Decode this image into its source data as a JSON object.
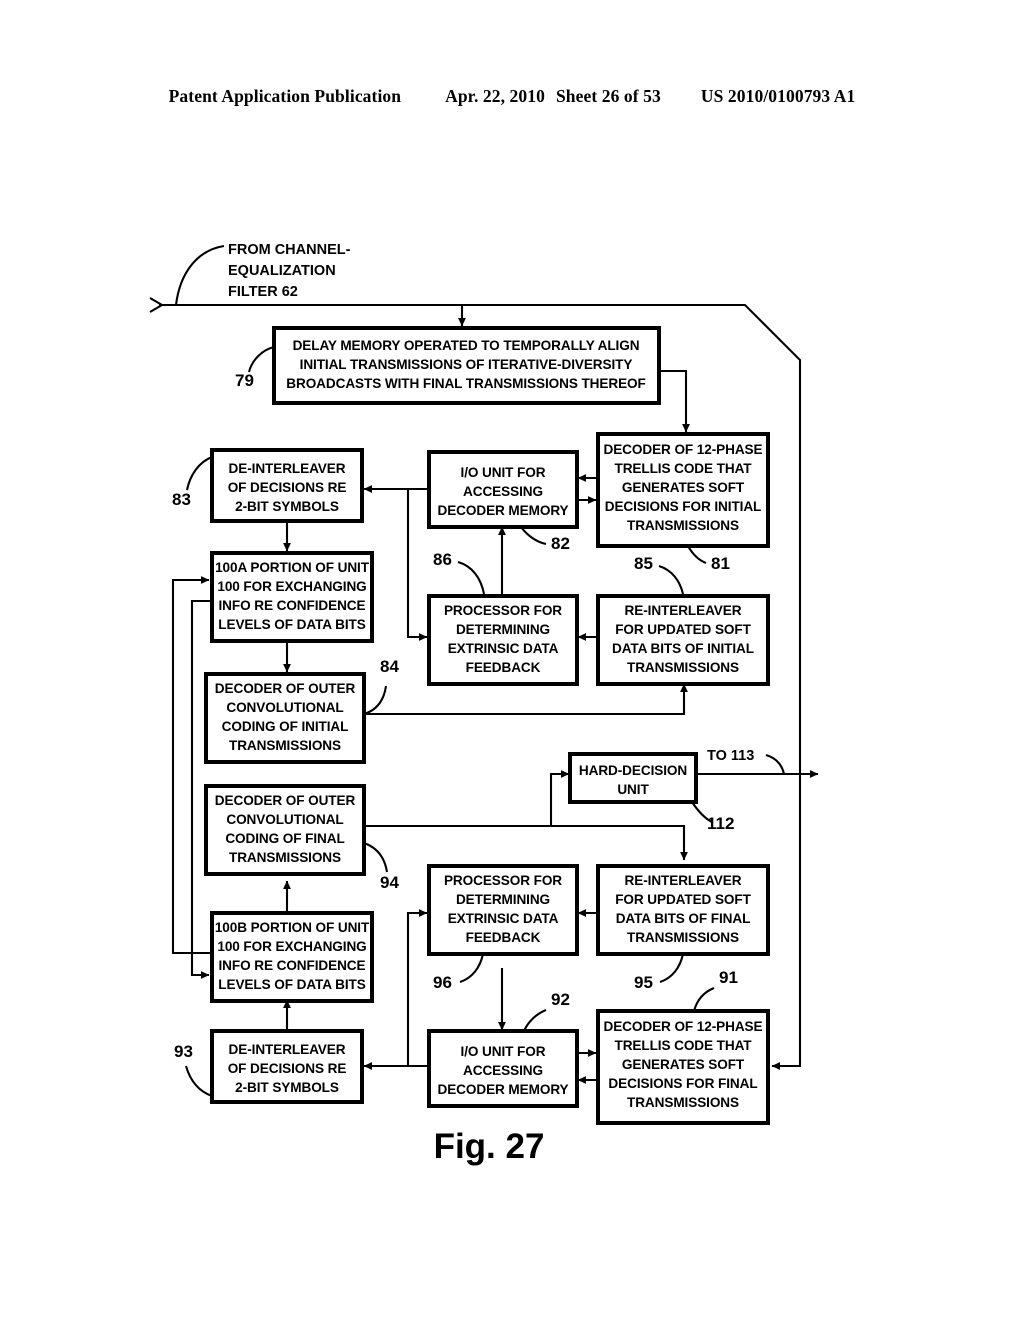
{
  "header": {
    "publication": "Patent Application Publication",
    "date": "Apr. 22, 2010",
    "sheet": "Sheet 26 of 53",
    "patent_number": "US 2010/0100793 A1"
  },
  "figure": {
    "caption": "Fig. 27",
    "input_annotation": [
      "FROM CHANNEL-",
      "EQUALIZATION",
      "FILTER 62"
    ],
    "output_annotation": "TO 113"
  },
  "blocks": [
    {
      "id": "b79",
      "ref": "79",
      "lines": [
        "DELAY MEMORY OPERATED TO TEMPORALLY ALIGN",
        "INITIAL TRANSMISSIONS OF ITERATIVE-DIVERSITY",
        "BROADCASTS WITH FINAL TRANSMISSIONS THEREOF"
      ]
    },
    {
      "id": "b83",
      "ref": "83",
      "lines": [
        "DE-INTERLEAVER",
        "OF DECISIONS RE",
        "2-BIT SYMBOLS"
      ]
    },
    {
      "id": "b82",
      "ref": "82",
      "lines": [
        "I/O UNIT FOR",
        "ACCESSING",
        "DECODER MEMORY"
      ]
    },
    {
      "id": "b81",
      "ref": "81",
      "lines": [
        "DECODER OF 12-PHASE",
        "TRELLIS CODE THAT",
        "GENERATES SOFT",
        "DECISIONS FOR INITIAL",
        "TRANSMISSIONS"
      ]
    },
    {
      "id": "b100a",
      "ref": "",
      "lines": [
        "100A PORTION OF UNIT",
        "100 FOR EXCHANGING",
        "INFO RE CONFIDENCE",
        "LEVELS OF DATA BITS"
      ]
    },
    {
      "id": "b86",
      "ref": "86",
      "lines": [
        "PROCESSOR FOR",
        "DETERMINING",
        "EXTRINSIC DATA",
        "FEEDBACK"
      ]
    },
    {
      "id": "b85",
      "ref": "85",
      "lines": [
        "RE-INTERLEAVER",
        "FOR UPDATED SOFT",
        "DATA BITS OF INITIAL",
        "TRANSMISSIONS"
      ]
    },
    {
      "id": "b84",
      "ref": "84",
      "lines": [
        "DECODER OF OUTER",
        "CONVOLUTIONAL",
        "CODING OF INITIAL",
        "TRANSMISSIONS"
      ]
    },
    {
      "id": "b112",
      "ref": "112",
      "lines": [
        "HARD-DECISION",
        "UNIT"
      ]
    },
    {
      "id": "b94",
      "ref": "94",
      "lines": [
        "DECODER OF OUTER",
        "CONVOLUTIONAL",
        "CODING OF FINAL",
        "TRANSMISSIONS"
      ]
    },
    {
      "id": "b96",
      "ref": "96",
      "lines": [
        "PROCESSOR FOR",
        "DETERMINING",
        "EXTRINSIC DATA",
        "FEEDBACK"
      ]
    },
    {
      "id": "b95",
      "ref": "95",
      "lines": [
        "RE-INTERLEAVER",
        "FOR UPDATED SOFT",
        "DATA BITS OF FINAL",
        "TRANSMISSIONS"
      ]
    },
    {
      "id": "b100b",
      "ref": "",
      "lines": [
        "100B PORTION OF UNIT",
        "100 FOR EXCHANGING",
        "INFO RE CONFIDENCE",
        "LEVELS OF DATA BITS"
      ]
    },
    {
      "id": "b93",
      "ref": "93",
      "lines": [
        "DE-INTERLEAVER",
        "OF DECISIONS RE",
        "2-BIT SYMBOLS"
      ]
    },
    {
      "id": "b92",
      "ref": "92",
      "lines": [
        "I/O UNIT FOR",
        "ACCESSING",
        "DECODER MEMORY"
      ]
    },
    {
      "id": "b91",
      "ref": "91",
      "lines": [
        "DECODER OF 12-PHASE",
        "TRELLIS CODE THAT",
        "GENERATES SOFT",
        "DECISIONS FOR FINAL",
        "TRANSMISSIONS"
      ]
    }
  ]
}
